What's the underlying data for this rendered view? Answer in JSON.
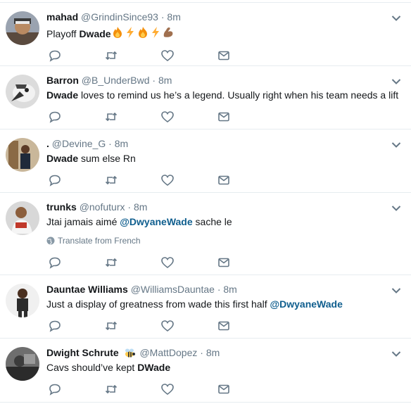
{
  "tweets": [
    {
      "name": "mahad",
      "handle": "@GrindinSince93",
      "dot": "·",
      "time": "8m",
      "text_pre": "Playoff ",
      "text_bold": "Dwade",
      "emojis": [
        "fire-emoji",
        "lightning-emoji",
        "fire-emoji",
        "lightning-emoji",
        "flexed-biceps-emoji"
      ]
    },
    {
      "name": "Barron",
      "handle": "@B_UnderBwd",
      "dot": "·",
      "time": "8m",
      "text_bold": "Dwade",
      "text_post": " loves to remind us he’s a legend. Usually right when his team needs a lift"
    },
    {
      "name": ".",
      "handle": "@Devine_G",
      "dot": "·",
      "time": "8m",
      "text_bold": "Dwade",
      "text_post": " sum else Rn"
    },
    {
      "name": "trunks",
      "handle": "@nofuturx",
      "dot": "·",
      "time": "8m",
      "text_pre": "Jtai jamais aimé ",
      "mention": "@DwyaneWade",
      "text_post": " sache le",
      "translate": "Translate from French"
    },
    {
      "name": "Dauntae Williams",
      "handle": "@WilliamsDauntae",
      "dot": "·",
      "time": "8m",
      "text_pre": "Just a display of greatness from wade this first half ",
      "mention": "@DwyaneWade"
    },
    {
      "name": "Dwight Schrute",
      "handle": "@MattDopez",
      "dot": "·",
      "time": "8m",
      "badge": "bee-emoji",
      "text_pre": "Cavs should’ve kept ",
      "text_bold": "DWade"
    }
  ],
  "icons": {
    "reply": "reply-icon",
    "retweet": "retweet-icon",
    "like": "heart-icon",
    "dm": "envelope-icon",
    "more": "chevron-down-icon",
    "globe": "globe-icon"
  },
  "colors": {
    "name": "#14171a",
    "secondary": "#657786",
    "mention": "#0f5e8e",
    "divider": "#e6ecf0"
  }
}
